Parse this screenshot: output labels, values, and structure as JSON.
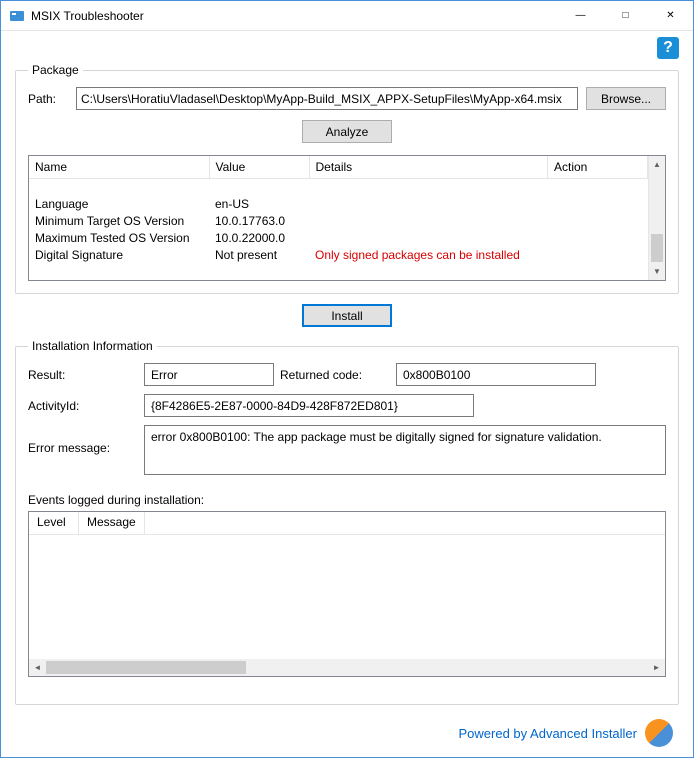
{
  "titlebar": {
    "title": "MSIX Troubleshooter"
  },
  "package": {
    "legend": "Package",
    "path_label": "Path:",
    "path_value": "C:\\Users\\HoratiuVladasel\\Desktop\\MyApp-Build_MSIX_APPX-SetupFiles\\MyApp-x64.msix",
    "browse_label": "Browse...",
    "analyze_label": "Analyze",
    "columns": {
      "name": "Name",
      "value": "Value",
      "details": "Details",
      "action": "Action"
    },
    "rows": [
      {
        "name": "Language",
        "value": "en-US",
        "details": "",
        "action": ""
      },
      {
        "name": "Minimum Target OS Version",
        "value": "10.0.17763.0",
        "details": "",
        "action": ""
      },
      {
        "name": "Maximum Tested OS Version",
        "value": "10.0.22000.0",
        "details": "",
        "action": ""
      },
      {
        "name": "Digital Signature",
        "value": "Not present",
        "details": "Only signed packages can be installed",
        "details_red": true,
        "action": ""
      }
    ]
  },
  "install_label": "Install",
  "install_info": {
    "legend": "Installation Information",
    "result_label": "Result:",
    "result_value": "Error",
    "returned_code_label": "Returned code:",
    "returned_code_value": "0x800B0100",
    "activity_label": "ActivityId:",
    "activity_value": "{8F4286E5-2E87-0000-84D9-428F872ED801}",
    "error_label": "Error message:",
    "error_value": "error 0x800B0100: The app package must be digitally signed for signature validation.",
    "events_label": "Events logged during installation:",
    "events_columns": {
      "level": "Level",
      "message": "Message"
    }
  },
  "footer": {
    "powered": "Powered by Advanced Installer"
  }
}
